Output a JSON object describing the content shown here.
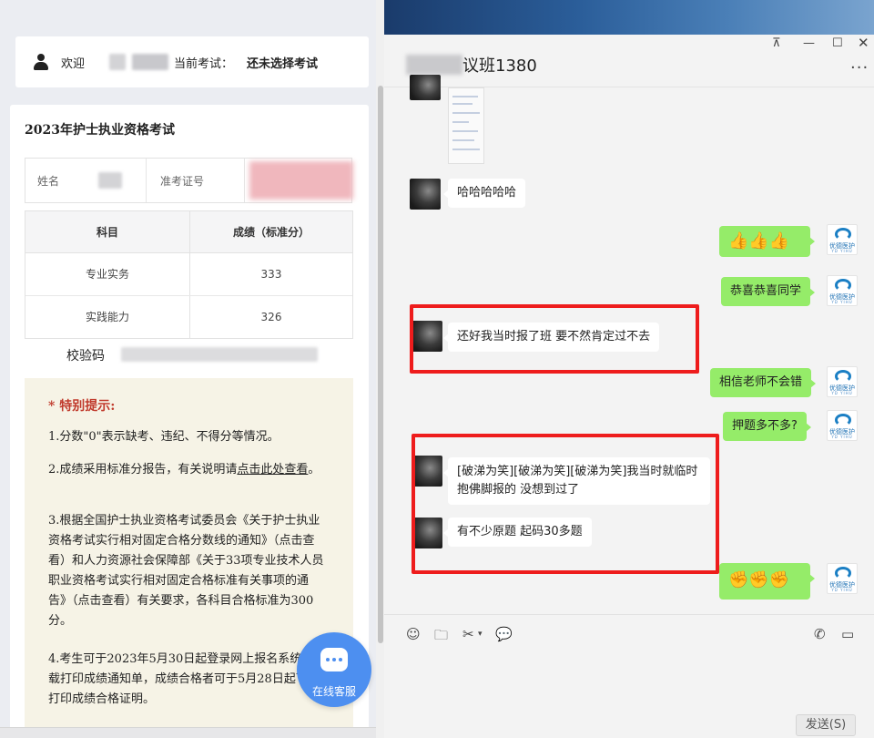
{
  "left": {
    "header": {
      "welcome": "欢迎",
      "current_exam_label": "当前考试：",
      "current_exam_value": "还未选择考试"
    },
    "card": {
      "title": "2023年护士执业资格考试",
      "name_label": "姓名",
      "exam_no_label": "准考证号",
      "score_headers": [
        "科目",
        "成绩（标准分）"
      ],
      "scores": [
        {
          "subject": "专业实务",
          "score": "333"
        },
        {
          "subject": "实践能力",
          "score": "326"
        }
      ],
      "verify_label": "校验码"
    },
    "notice": {
      "title": "* 特别提示:",
      "p1": "1.分数\"0\"表示缺考、违纪、不得分等情况。",
      "p2_a": "2.成绩采用标准分报告，有关说明请",
      "p2_link": "点击此处查看",
      "p2_b": "。",
      "p3": "3.根据全国护士执业资格考试委员会《关于护士执业资格考试实行相对固定合格分数线的通知》（点击查看）和人力资源社会保障部《关于33项专业技术人员职业资格考试实行相对固定合格标准有关事项的通告》（点击查看）有关要求，各科目合格标准为300分。",
      "p4": "4.考生可于2023年5月30日起登录网上报名系统下载打印成绩通知单，成绩合格者可于5月28日起下载打印成绩合格证明。"
    },
    "service_label": "在线客服"
  },
  "chat": {
    "title": "议班1380",
    "window_buttons": {
      "pin": "⊼",
      "min": "—",
      "max": "☐",
      "close": "✕"
    },
    "more": "···",
    "messages": [
      {
        "side": "in",
        "text": "哈哈哈哈哈"
      },
      {
        "side": "out",
        "text": "👍👍👍"
      },
      {
        "side": "out",
        "text": "恭喜恭喜同学"
      },
      {
        "side": "in",
        "text": "还好我当时报了班  要不然肯定过不去"
      },
      {
        "side": "out",
        "text": "相信老师不会错"
      },
      {
        "side": "out",
        "text": "押题多不多?"
      },
      {
        "side": "in",
        "text": "[破涕为笑][破涕为笑][破涕为笑]我当时就临时抱佛脚报的  没想到过了"
      },
      {
        "side": "in",
        "text": "有不少原题  起码30多题"
      },
      {
        "side": "out",
        "text": "✊✊✊"
      }
    ],
    "logo_brand": "优德医护",
    "logo_sub": "YD YIHU",
    "send_label": "发送(S)"
  },
  "icons": {
    "emoji": "☺",
    "folder": "🗀",
    "cut": "✂",
    "cut_arrow": "▾",
    "chat_history": "💬",
    "phone": "✆",
    "video": "▭"
  },
  "colors": {
    "outgoing_bubble": "#95ec69",
    "annotation": "#ee1c1c",
    "service_button": "#4d8ff0"
  }
}
